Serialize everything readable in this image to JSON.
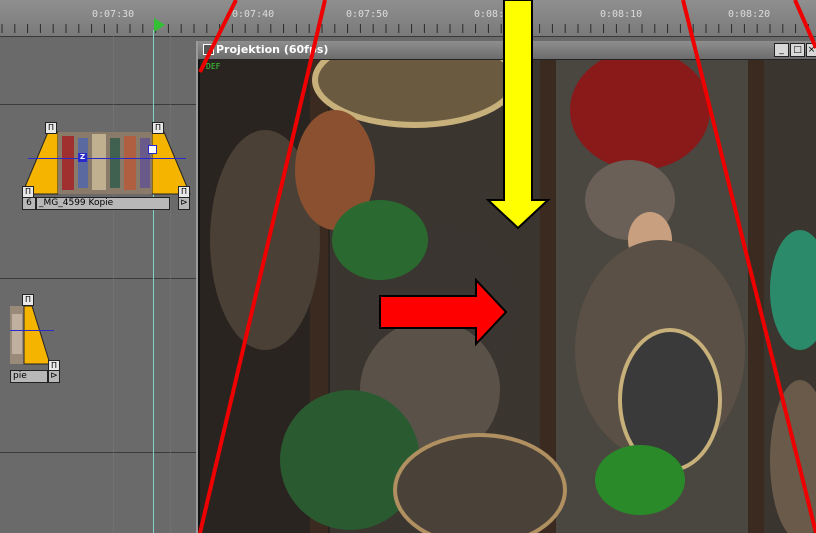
{
  "ruler": {
    "timecodes": [
      "0:07:30",
      "0:07:40",
      "0:07:50",
      "0:08:00",
      "0:08:10",
      "0:08:20"
    ]
  },
  "clips": [
    {
      "label": "_MG_4599 Kopie",
      "number": "6",
      "keyframe_label": "Z"
    },
    {
      "label": "pie"
    }
  ],
  "handles": {
    "marker": "П",
    "end_marker": "⊳"
  },
  "preview_window": {
    "title": "Projektion (60fps)",
    "hud_text": "DEF",
    "buttons": {
      "minimize": "_",
      "maximize": "□",
      "close": "×"
    }
  },
  "annotations": {
    "arrow_down_color": "#ffff00",
    "arrow_right_color": "#ff0000",
    "guide_line_color": "#ee0000"
  },
  "colors": {
    "clip_fill": "#f5b400",
    "keyframe": "#2a2acc",
    "playhead": "#7fd4c8",
    "play_flag": "#34c034"
  }
}
